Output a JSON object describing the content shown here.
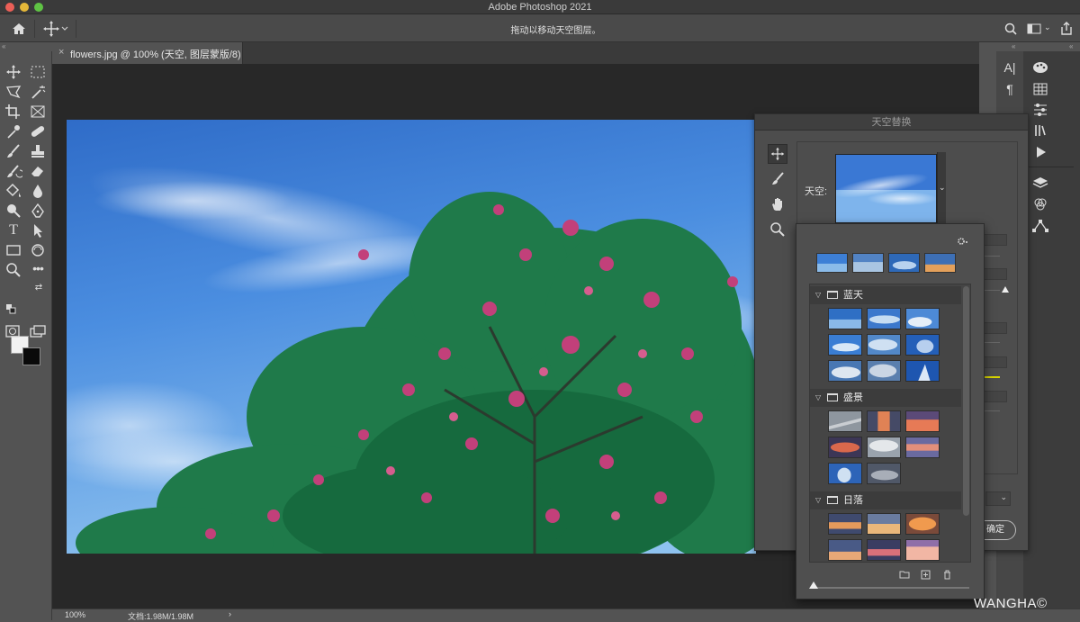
{
  "app": {
    "title": "Adobe Photoshop 2021"
  },
  "options_bar": {
    "hint": "拖动以移动天空图层。"
  },
  "document": {
    "tab_title": "flowers.jpg @ 100% (天空, 图层蒙版/8)",
    "close": "×"
  },
  "status": {
    "zoom": "100%",
    "doc_info": "文档:1.98M/1.98M",
    "arrow": "›"
  },
  "dialog": {
    "title": "天空替换",
    "sky_label": "天空:",
    "ok_label": "确定",
    "dropdown_arrow": "⌄"
  },
  "presets": {
    "groups": [
      {
        "name": "蓝天",
        "count": 9
      },
      {
        "name": "盛景",
        "count": 8
      },
      {
        "name": "日落",
        "count": 6
      }
    ]
  },
  "watermark": {
    "text": "WANGHA©"
  },
  "colors": {
    "foreground": "#f2f2f2",
    "background": "#0a0a0a",
    "accent_slider": "#d7d400"
  },
  "icons": {
    "toolbar": [
      "move-icon",
      "marquee-icon",
      "lasso-icon",
      "magic-wand-icon",
      "crop-icon",
      "frame-icon",
      "eyedropper-icon",
      "healing-icon",
      "brush-icon",
      "stamp-icon",
      "history-brush-icon",
      "eraser-icon",
      "paint-bucket-icon",
      "blur-icon",
      "dodge-icon",
      "pen-icon",
      "type-icon",
      "path-select-icon",
      "rectangle-icon",
      "rotate-view-icon",
      "zoom-icon",
      "more-tools-icon"
    ]
  }
}
